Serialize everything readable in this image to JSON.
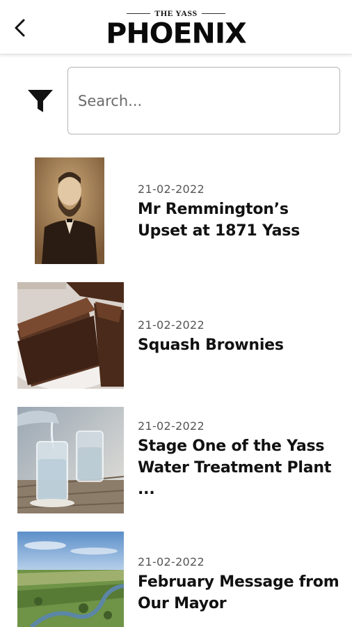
{
  "header": {
    "back_icon": "chevron-left-icon",
    "logo_small": "THE YASS",
    "logo_big": "PHOENIX"
  },
  "search": {
    "filter_icon": "filter-icon",
    "placeholder": "Search...",
    "value": ""
  },
  "articles": [
    {
      "date": "21-02-2022",
      "title": "Mr Remmington’s Upset at 1871 Yass",
      "image": "portrait-photo"
    },
    {
      "date": "21-02-2022",
      "title": "Squash Brownies",
      "image": "brownies-photo"
    },
    {
      "date": "21-02-2022",
      "title": "Stage One of the Yass Water Treatment Plant ...",
      "image": "water-glass-photo"
    },
    {
      "date": "21-02-2022",
      "title": "February Message from Our Mayor",
      "image": "landscape-photo"
    }
  ],
  "colors": {
    "text": "#111111",
    "date": "#555555",
    "border": "#b5b5b5"
  }
}
